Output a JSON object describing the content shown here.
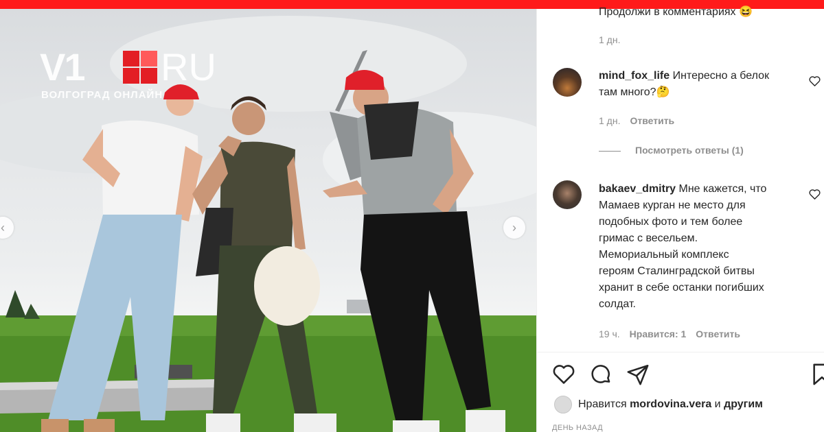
{
  "colors": {
    "brand_red": "#ff1a1a",
    "text": "#262626",
    "muted": "#8e8e8e"
  },
  "logo": {
    "main": "V1",
    "suffix": "RU",
    "subtitle": "ВОЛГОГРАД ОНЛАЙН"
  },
  "photo": {
    "prev_icon": "chevron-left-icon",
    "next_icon": "chevron-right-icon",
    "prev_glyph": "‹",
    "next_glyph": "›"
  },
  "comments": [
    {
      "text": "Продолжи в комментариях 😆",
      "time": "1 дн."
    },
    {
      "username": "mind_fox_life",
      "text_line1": "Интересно а белок",
      "text_line2": "там много?🤔",
      "time": "1 дн.",
      "reply": "Ответить",
      "view_replies": "Посмотреть ответы (1)"
    },
    {
      "username": "bakaev_dmitry",
      "lines": [
        "Мне кажется, что",
        "Мамаев курган не место для",
        "подобных фото и тем более",
        "гримас с весельем.",
        "Мемориальный комплекс",
        "героям Сталинградской битвы",
        "хранит в себе останки погибших",
        "солдат."
      ],
      "time": "19 ч.",
      "likes": "Нравится: 1",
      "reply": "Ответить"
    }
  ],
  "post": {
    "likes_prefix": "Нравится",
    "likes_user": "mordovina.vera",
    "likes_conj": "и",
    "likes_others": "другим",
    "time": "ДЕНЬ НАЗАД",
    "icons": [
      "heart-icon",
      "comment-icon",
      "share-icon",
      "bookmark-icon"
    ]
  }
}
